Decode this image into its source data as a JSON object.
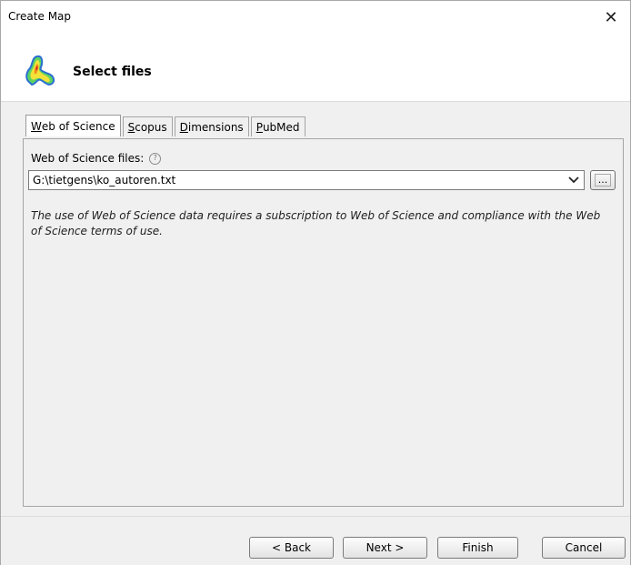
{
  "window": {
    "title": "Create Map",
    "close_glyph": "✕"
  },
  "header": {
    "title": "Select files",
    "icon": "density-map-icon"
  },
  "tabs": [
    {
      "label_hot": "W",
      "label_rest": "eb of Science",
      "active": true
    },
    {
      "label_hot": "S",
      "label_rest": "copus",
      "active": false
    },
    {
      "label_hot": "D",
      "label_rest": "imensions",
      "active": false
    },
    {
      "label_hot": "P",
      "label_rest": "ubMed",
      "active": false
    }
  ],
  "panel": {
    "files_label": "Web of Science files:",
    "help_glyph": "?",
    "selected_file": "G:\\tietgens\\ko_autoren.txt",
    "browse_label": "...",
    "notice": "The use of Web of Science data requires a subscription to Web of Science and compliance with the Web of Science terms of use."
  },
  "footer": {
    "back_label": "< Back",
    "next_label": "Next >",
    "finish_label": "Finish",
    "cancel_label": "Cancel"
  }
}
